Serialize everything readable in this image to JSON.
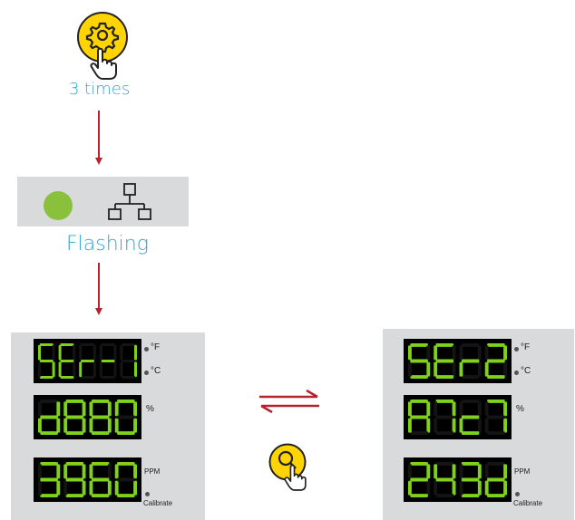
{
  "step1": {
    "caption": "3 times"
  },
  "step2": {
    "caption": "Flashing"
  },
  "display_left": {
    "rows": [
      {
        "chars": [
          "5",
          "E",
          "r",
          "-",
          "1"
        ],
        "units": [
          "°F",
          "°C"
        ]
      },
      {
        "chars": [
          "d",
          "8",
          "8",
          "0"
        ],
        "units": [
          "%"
        ]
      },
      {
        "chars": [
          "3",
          "9",
          "6",
          "0"
        ],
        "units": [
          "PPM",
          "Calibrate"
        ]
      }
    ]
  },
  "display_right": {
    "rows": [
      {
        "chars": [
          "5",
          "E",
          "r",
          "2"
        ],
        "units": [
          "°F",
          "°C"
        ]
      },
      {
        "chars": [
          "A",
          "7",
          "c",
          "7"
        ],
        "units": [
          "%"
        ]
      },
      {
        "chars": [
          "2",
          "4",
          "3",
          "d"
        ],
        "units": [
          "PPM",
          "Calibrate"
        ]
      }
    ]
  },
  "colors": {
    "accent_yellow": "#ffd400",
    "led_green": "#8ac13c",
    "segment_green": "#7ed21b",
    "arrow_red": "#b3242f",
    "caption_blue": "#2ea3d6",
    "panel_gray": "#d9dadb"
  },
  "icons": {
    "gear_button": "gear-icon",
    "hand": "pointer-hand-icon",
    "network": "network-icon",
    "search_button": "search-icon"
  }
}
